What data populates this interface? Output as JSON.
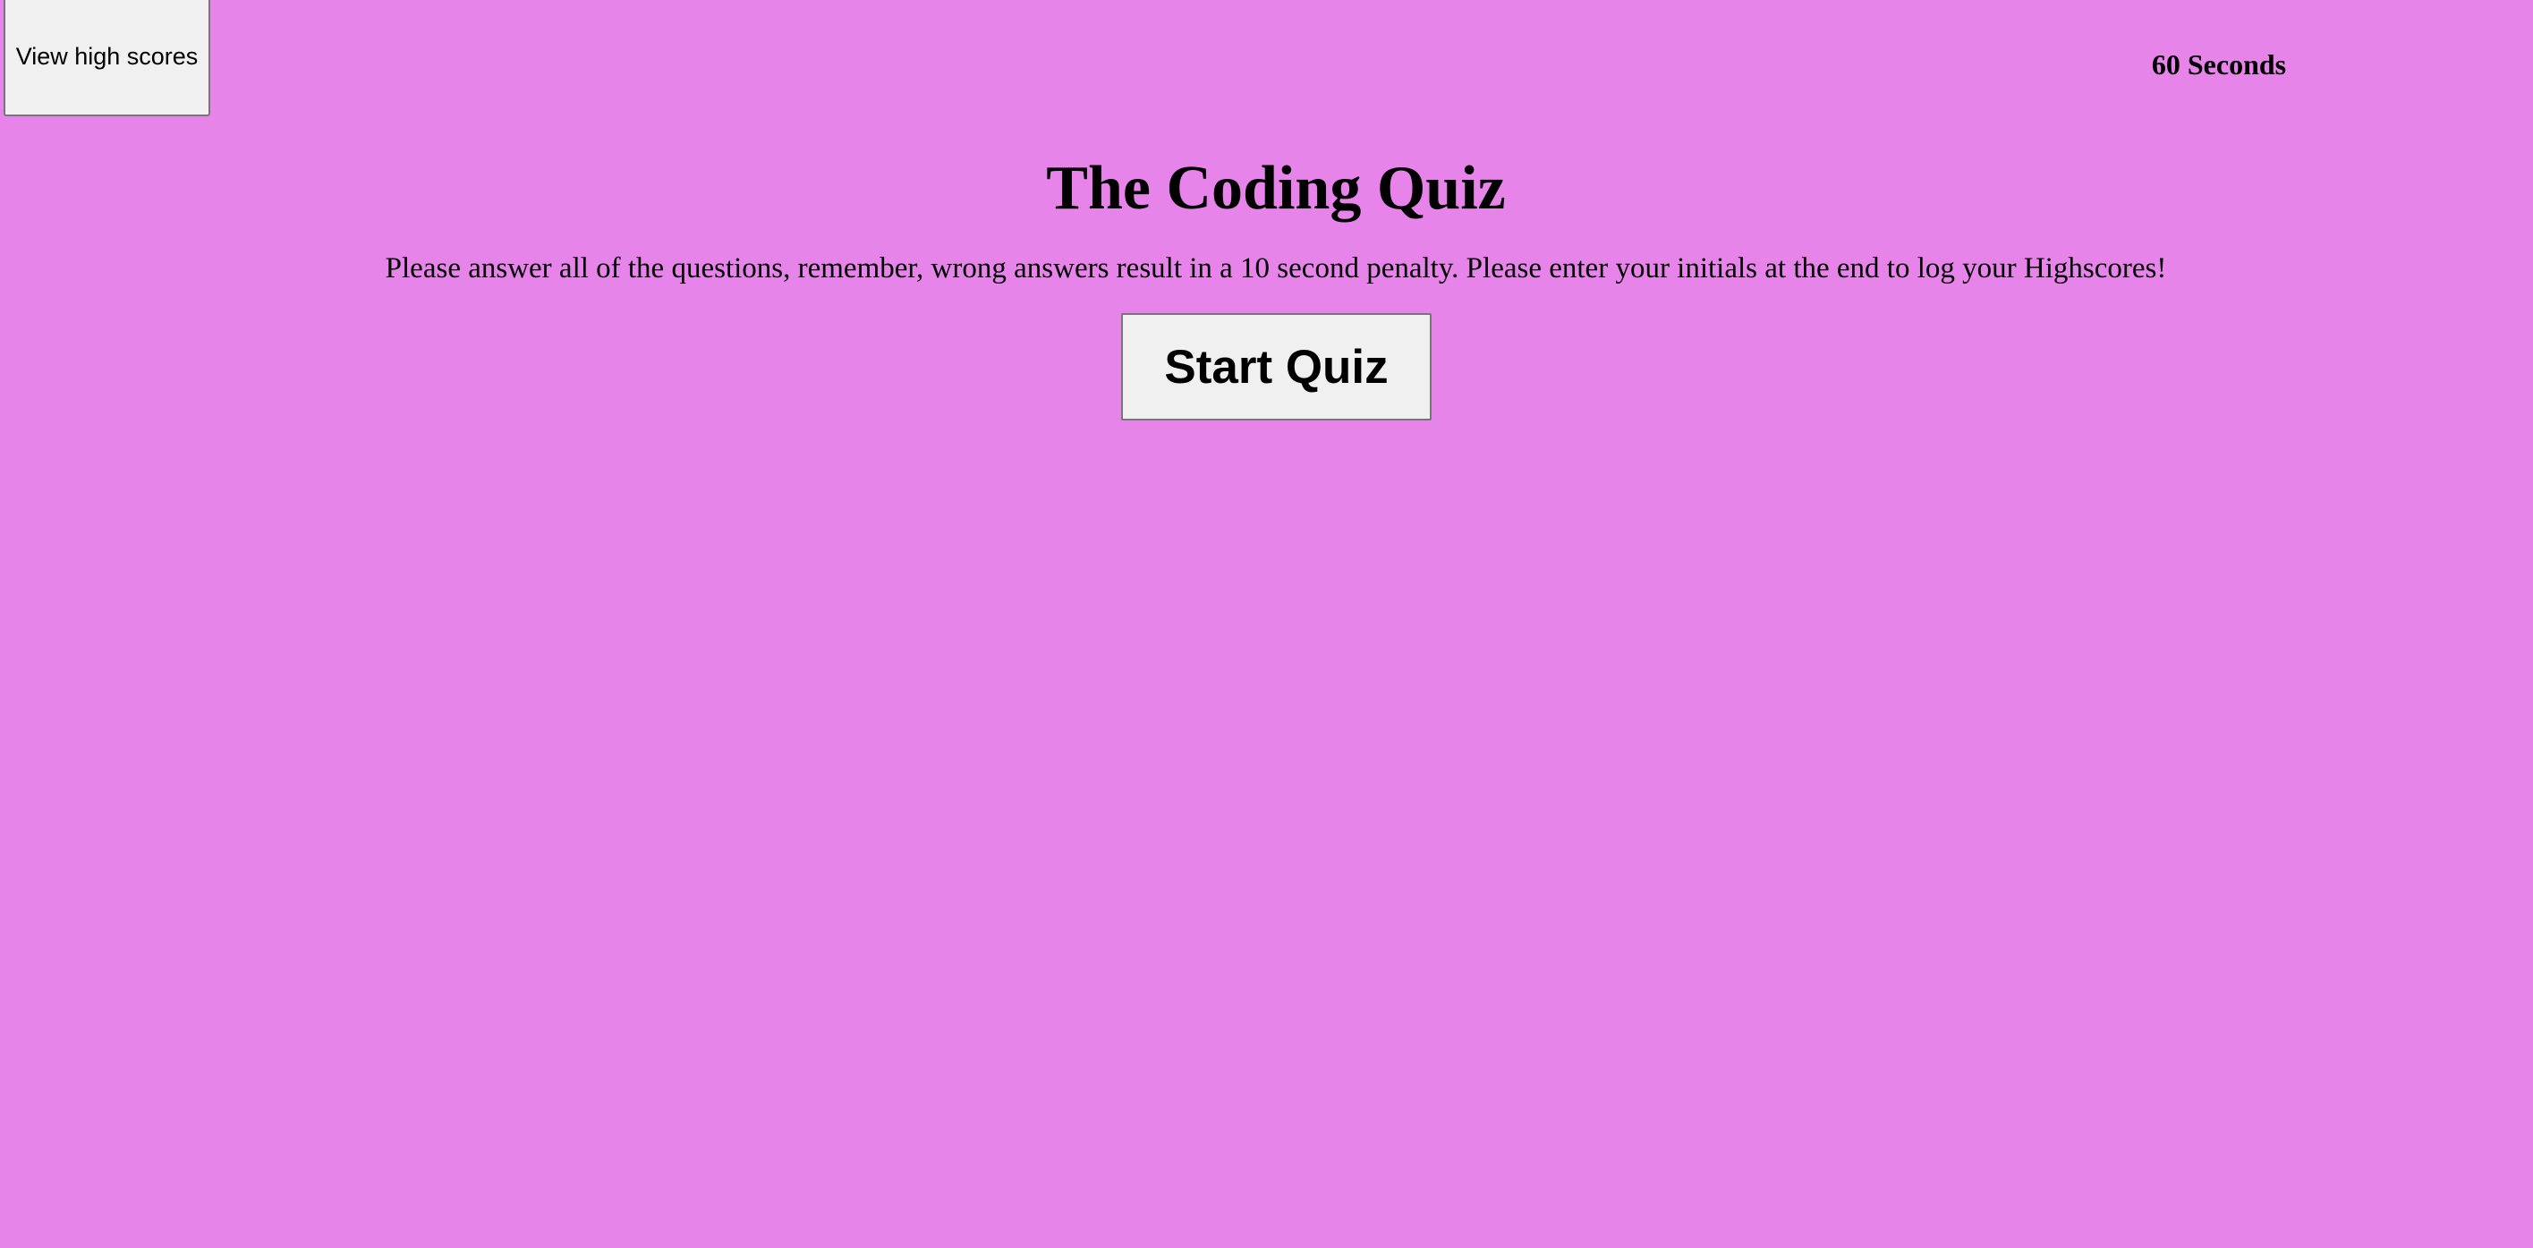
{
  "header": {
    "high_scores_label": "View high scores",
    "timer_text": "60 Seconds"
  },
  "main": {
    "title": "The Coding Quiz",
    "instructions": "Please answer all of the questions, remember, wrong answers result in a 10 second penalty. Please enter your initials at the end to log your Highscores!",
    "start_label": "Start Quiz"
  },
  "colors": {
    "background": "#e784e9",
    "button_face": "#f0f0f0",
    "button_border": "#767676"
  }
}
